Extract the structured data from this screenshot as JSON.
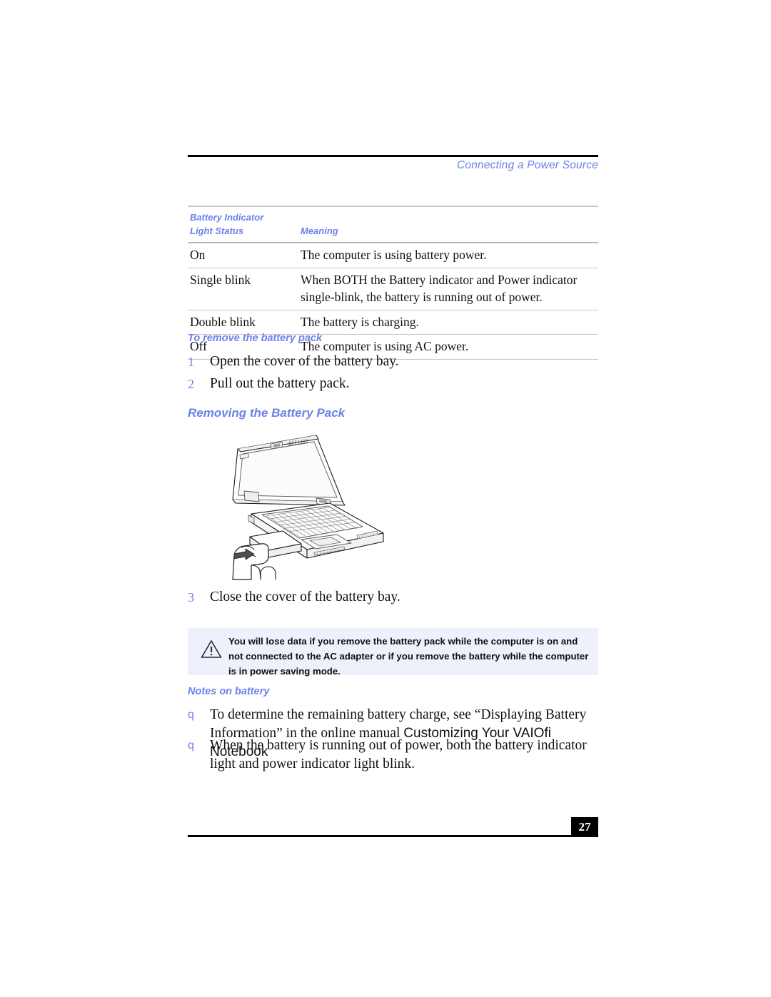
{
  "header": {
    "title": "Connecting a Power Source"
  },
  "table": {
    "caption_line1": "Battery Indicator",
    "columns": [
      "Light Status",
      "Meaning"
    ],
    "rows": [
      {
        "status": "On",
        "meaning": "The computer is using battery power."
      },
      {
        "status": "Single blink",
        "meaning": "When BOTH the Battery indicator and Power indicator single-blink, the battery is running out of power."
      },
      {
        "status": "Double blink",
        "meaning": "The battery is charging."
      },
      {
        "status": "Off",
        "meaning": "The computer is using AC power."
      }
    ]
  },
  "sections": {
    "remove_heading": "To remove the battery pack",
    "notes_heading": "Notes on battery",
    "figure_caption": "Removing the Battery Pack"
  },
  "steps": [
    {
      "num": "1",
      "text": "Open the cover of the battery bay."
    },
    {
      "num": "2",
      "text": "Pull out the battery pack."
    },
    {
      "num": "3",
      "text": "Close the cover of the battery bay."
    }
  ],
  "warning": {
    "icon": "warning-triangle-icon",
    "text": "You will lose data if you remove the battery pack while the computer is on and not connected to the AC adapter or if you remove the battery while the computer is in power saving mode."
  },
  "notes": [
    {
      "bullet": "q",
      "text_before": "To determine the remaining battery charge, see “Displaying Battery Information” in the online manual ",
      "title": "Customizing Your VAIOfi Notebook",
      "text_after": ""
    },
    {
      "bullet": "q",
      "text_before": "When the battery is running out of power, both the battery indicator light and power indicator light blink.",
      "title": "",
      "text_after": ""
    }
  ],
  "footer": {
    "page_number": "27"
  },
  "figure": {
    "alt": "laptop-battery-removal-illustration"
  },
  "colors": {
    "accent_blue": "#6b82e8",
    "warning_bg": "#eef0fb",
    "rule_black": "#000000",
    "table_rule": "#c3c3c3"
  }
}
